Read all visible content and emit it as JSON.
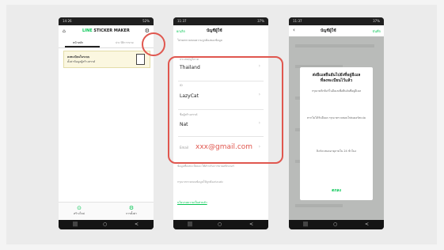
{
  "app": {
    "title_prefix": "LINE",
    "title_suffix": "STICKER MAKER"
  },
  "phone1": {
    "status_time": "14:26",
    "status_right": "52%",
    "tab_active": "หน้าหลัก",
    "tab_inactive": "ประวัติการขาย",
    "banner_line1": "ลงทะเบียนในระบบ",
    "banner_line2": "ตั้งค่าข้อมูลผู้สร้างสรรค์",
    "bottom_left": "สร้างใหม่",
    "bottom_right": "การตั้งค่า"
  },
  "phone2": {
    "status_time": "11:37",
    "status_right": "37%",
    "back_label": "ยกเลิก",
    "title": "บัญชีผู้ใช้",
    "note": "โปรดตรวจสอบความถูกต้องของข้อมูล",
    "field1_label": "ประเทศ/ภูมิภาค",
    "field1_value": "Thailand",
    "field2_label": "ID",
    "field2_value": "LazyCat",
    "field3_label": "ชื่อผู้สร้างสรรค์",
    "field3_value": "Nat",
    "field4_label": "Email",
    "field4_value": "xxx@gmail.com",
    "para1": "ข้อมูลที่ลงทะเบียนจะใช้สำหรับการขายสติกเกอร์",
    "para2": "กรุณาตรวจสอบข้อมูลให้ถูกต้องก่อนส่ง",
    "link": "นโยบายความเป็นส่วนตัว"
  },
  "phone3": {
    "status_time": "11:37",
    "status_right": "37%",
    "title": "บัญชีผู้ใช้",
    "right_label": "บันทึก",
    "dialog_title_line1": "ส่งอีเมลยืนยันไปยังที่อยู่อีเมล",
    "dialog_title_line2": "ที่ลงทะเบียนไว้แล้ว",
    "dialog_body1": "กรุณาคลิกลิงก์ในอีเมลเพื่อยืนยันที่อยู่อีเมล",
    "dialog_body2": "หากไม่ได้รับอีเมล กรุณาตรวจสอบโฟลเดอร์สแปม",
    "dialog_body3": "ลิงก์จะหมดอายุภายใน 24 ชั่วโมง",
    "ok_label": "ตกลง"
  },
  "icons": {
    "home": "⌂",
    "gear": "⚙",
    "chevron": "›",
    "back": "‹",
    "nav_recent": "|||",
    "nav_home": "○",
    "nav_back": "<",
    "create": "⊙",
    "settings": "⚙"
  },
  "colors": {
    "line_green": "#06c755",
    "highlight_red": "#e0574f"
  }
}
